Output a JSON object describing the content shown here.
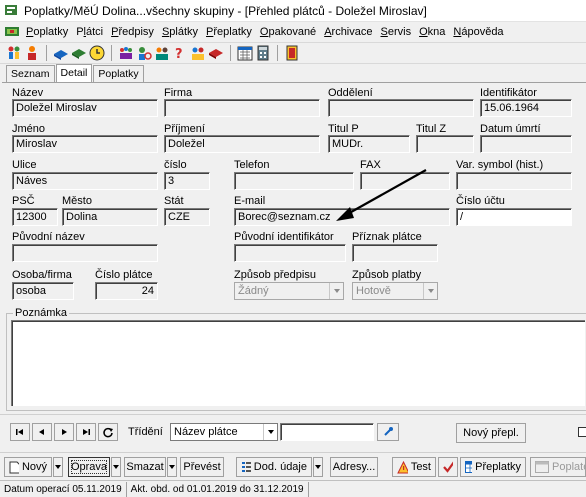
{
  "window": {
    "title": "Poplatky/MěÚ Dolina...všechny skupiny - [Přehled plátců - Doležel Miroslav]"
  },
  "menu": [
    {
      "label": "Poplatky",
      "accel": "P"
    },
    {
      "label": "Plátci",
      "accel": "l"
    },
    {
      "label": "Předpisy",
      "accel": "P"
    },
    {
      "label": "Splátky",
      "accel": "S"
    },
    {
      "label": "Přeplatky",
      "accel": "P"
    },
    {
      "label": "Opakované",
      "accel": "O"
    },
    {
      "label": "Archivace",
      "accel": "A"
    },
    {
      "label": "Servis",
      "accel": "S"
    },
    {
      "label": "Okna",
      "accel": "O"
    },
    {
      "label": "Nápověda",
      "accel": "N"
    }
  ],
  "tabs": [
    "Seznam",
    "Detail",
    "Poplatky"
  ],
  "form": {
    "nazev": {
      "label": "Název",
      "value": "Doležel Miroslav"
    },
    "firma": {
      "label": "Firma",
      "value": ""
    },
    "oddeleni": {
      "label": "Oddělení",
      "value": ""
    },
    "identifikator": {
      "label": "Identifikátor",
      "value": "15.06.1964"
    },
    "jmeno": {
      "label": "Jméno",
      "value": "Miroslav"
    },
    "prijmeni": {
      "label": "Příjmení",
      "value": "Doležel"
    },
    "titul_p": {
      "label": "Titul P",
      "value": "MUDr."
    },
    "titul_z": {
      "label": "Titul Z",
      "value": ""
    },
    "datum_umrti": {
      "label": "Datum úmrtí",
      "value": ""
    },
    "ulice": {
      "label": "Ulice",
      "value": "Náves"
    },
    "cislo": {
      "label": "číslo",
      "value": "3"
    },
    "telefon": {
      "label": "Telefon",
      "value": ""
    },
    "fax": {
      "label": "FAX",
      "value": ""
    },
    "var_symbol": {
      "label": "Var. symbol (hist.)",
      "value": ""
    },
    "psc": {
      "label": "PSČ",
      "value": "12300"
    },
    "mesto": {
      "label": "Město",
      "value": "Dolina"
    },
    "stat": {
      "label": "Stát",
      "value": "CZE"
    },
    "email": {
      "label": "E-mail",
      "value": "Borec@seznam.cz"
    },
    "cislo_uctu": {
      "label": "Číslo účtu",
      "value": "/"
    },
    "puvodni_nazev": {
      "label": "Původní název",
      "value": ""
    },
    "puvodni_identifikator": {
      "label": "Původní identifikátor",
      "value": ""
    },
    "priznak_platce": {
      "label": "Příznak plátce",
      "value": ""
    },
    "osoba_firma": {
      "label": "Osoba/firma",
      "value": "osoba"
    },
    "cislo_platce": {
      "label": "Číslo plátce",
      "value": "24"
    },
    "zpusob_predpisu": {
      "label": "Způsob předpisu",
      "value": "Žádný"
    },
    "zpusob_platby": {
      "label": "Způsob platby",
      "value": "Hotově"
    },
    "poznamka": {
      "label": "Poznámka",
      "value": ""
    }
  },
  "nav": {
    "trideni_label": "Třídění",
    "trideni_value": "Název plátce",
    "filter_value": "",
    "novy_prepl": "Nový přepl."
  },
  "actions": {
    "novy": "Nový",
    "oprava": "Oprava",
    "smazat": "Smazat",
    "prevest": "Převést",
    "dod_udaje": "Dod. údaje",
    "adresy": "Adresy...",
    "test": "Test",
    "preplatky": "Přeplatky",
    "poplatek": "Poplate"
  },
  "status": {
    "datum_operaci": "Datum operací 05.11.2019",
    "obdobi": "Akt. obd. od 01.01.2019 do 31.12.2019"
  },
  "colors": {
    "arrow": "#000000",
    "field_bg": "#f0f0f0",
    "input_bg": "#ffffff"
  }
}
